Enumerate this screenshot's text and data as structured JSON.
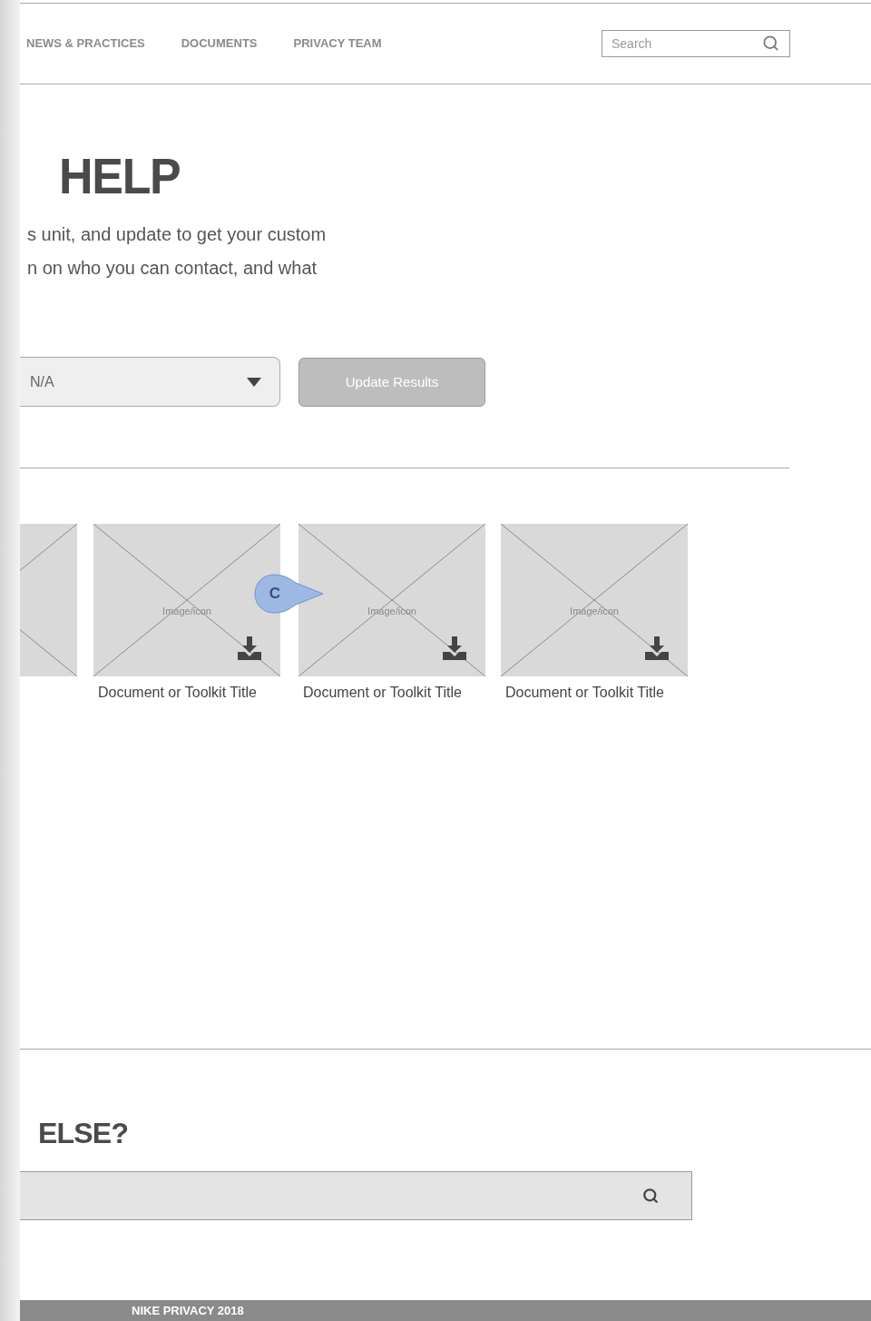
{
  "nav": {
    "items": [
      {
        "label": "NEWS & PRACTICES"
      },
      {
        "label": "DOCUMENTS"
      },
      {
        "label": "PRIVACY TEAM"
      }
    ],
    "search": {
      "placeholder": "Search"
    }
  },
  "intro": {
    "heading": "HELP",
    "lines": [
      "s unit, and update to get your custom",
      "n on who you can contact, and what"
    ]
  },
  "filter": {
    "dropdown_value": "N/A",
    "button": {
      "label": "Update Results",
      "disabled": true
    }
  },
  "cards": [
    {
      "image_label": "Image/icon",
      "title": "Document or Toolkit Title"
    },
    {
      "image_label": "Image/icon",
      "title": "Document or Toolkit Title"
    },
    {
      "image_label": "Image/icon",
      "title": "Document or Toolkit Title"
    }
  ],
  "comment_marker": {
    "label": "C"
  },
  "help": {
    "heading": "ELSE?"
  },
  "footer": {
    "text": "NIKE PRIVACY 2018"
  }
}
